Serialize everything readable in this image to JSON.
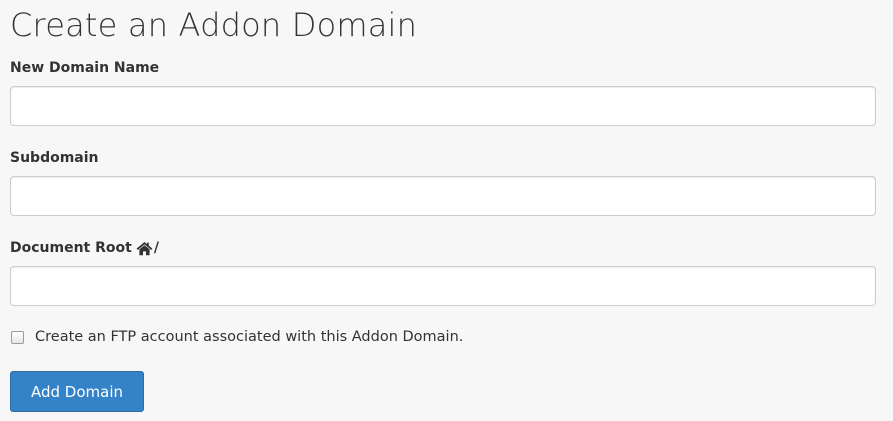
{
  "page": {
    "title": "Create an Addon Domain"
  },
  "form": {
    "new_domain_name": {
      "label": "New Domain Name",
      "value": ""
    },
    "subdomain": {
      "label": "Subdomain",
      "value": ""
    },
    "document_root": {
      "label": "Document Root",
      "suffix": "/",
      "icon": "home-icon",
      "value": ""
    },
    "ftp_checkbox": {
      "label": "Create an FTP account associated with this Addon Domain.",
      "checked": false
    },
    "submit": {
      "label": "Add Domain"
    }
  },
  "colors": {
    "background": "#f7f7f7",
    "primary_button": "#3483c9",
    "border": "#cccccc",
    "text": "#333333"
  }
}
